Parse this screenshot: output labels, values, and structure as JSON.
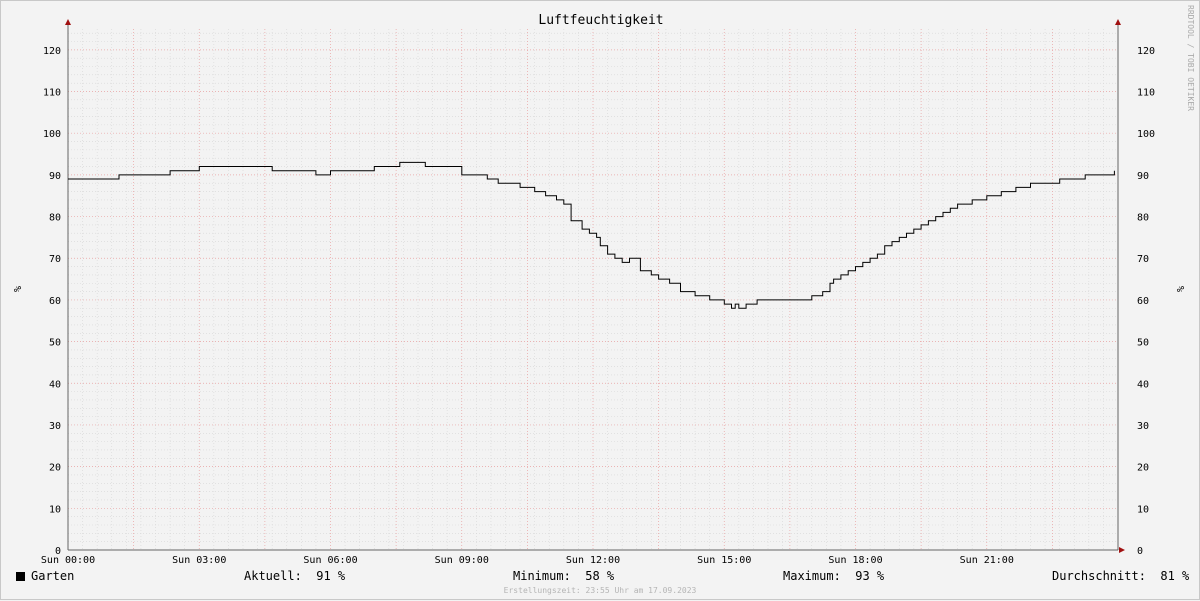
{
  "chart_data": {
    "type": "line",
    "title": "Luftfeuchtigkeit",
    "ylabel": "%",
    "ylim": [
      0,
      125
    ],
    "y_ticks": [
      0,
      10,
      20,
      30,
      40,
      50,
      60,
      70,
      80,
      90,
      100,
      110,
      120
    ],
    "xlim": [
      "Sun 00:00",
      "Sun 24:00"
    ],
    "x_tick_labels": [
      "Sun 00:00",
      "Sun 03:00",
      "Sun 06:00",
      "Sun 09:00",
      "Sun 12:00",
      "Sun 15:00",
      "Sun 18:00",
      "Sun 21:00"
    ],
    "grid": true,
    "series": [
      {
        "name": "Garten",
        "color": "#000000",
        "x": [
          "00:00",
          "01:10",
          "02:20",
          "03:00",
          "04:40",
          "05:40",
          "06:00",
          "07:00",
          "07:35",
          "08:10",
          "09:00",
          "09:35",
          "09:50",
          "10:20",
          "10:40",
          "10:55",
          "11:10",
          "11:20",
          "11:30",
          "11:45",
          "11:55",
          "12:05",
          "12:10",
          "12:20",
          "12:30",
          "12:40",
          "12:50",
          "13:05",
          "13:10",
          "13:20",
          "13:30",
          "13:45",
          "14:00",
          "14:20",
          "14:40",
          "15:00",
          "15:10",
          "15:15",
          "15:20",
          "15:30",
          "15:45",
          "16:00",
          "17:00",
          "17:15",
          "17:25",
          "17:30",
          "17:40",
          "17:50",
          "18:00",
          "18:10",
          "18:20",
          "18:30",
          "18:40",
          "18:50",
          "19:00",
          "19:10",
          "19:20",
          "19:30",
          "19:40",
          "19:50",
          "20:00",
          "20:10",
          "20:20",
          "20:40",
          "21:00",
          "21:20",
          "21:40",
          "22:00",
          "22:40",
          "23:15",
          "23:55"
        ],
        "values": [
          89,
          90,
          91,
          92,
          91,
          90,
          91,
          92,
          93,
          92,
          90,
          89,
          88,
          87,
          86,
          85,
          84,
          83,
          79,
          77,
          76,
          75,
          73,
          71,
          70,
          69,
          70,
          67,
          67,
          66,
          65,
          64,
          62,
          61,
          60,
          59,
          58,
          59,
          58,
          59,
          60,
          60,
          61,
          62,
          64,
          65,
          66,
          67,
          68,
          69,
          70,
          71,
          73,
          74,
          75,
          76,
          77,
          78,
          79,
          80,
          81,
          82,
          83,
          84,
          85,
          86,
          87,
          88,
          89,
          90,
          91
        ]
      }
    ]
  },
  "stats": {
    "series_name": "Garten",
    "current_label": "Aktuell:",
    "current_value": "91 %",
    "min_label": "Minimum:",
    "min_value": "58 %",
    "max_label": "Maximum:",
    "max_value": "93 %",
    "avg_label": "Durchschnitt:",
    "avg_value": "81 %"
  },
  "watermark": "RRDTOOL / TOBI OETIKER",
  "footer": "Erstellungszeit: 23:55 Uhr am 17.09.2023"
}
